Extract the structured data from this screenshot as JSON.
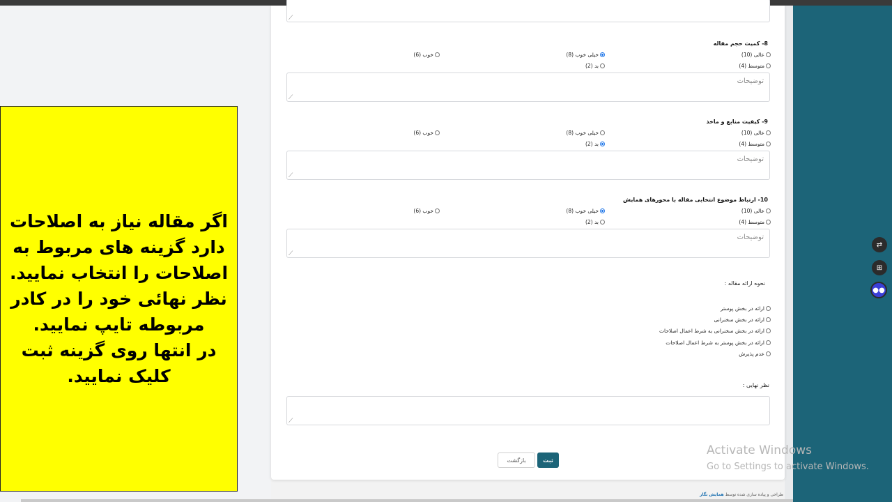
{
  "form": {
    "comments_placeholder": "توضیحات",
    "questions": [
      {
        "title": "8- کمیت حجم مقاله",
        "options": {
          "excellent": "عالی (10)",
          "very_good": "خیلی خوب (8)",
          "good": "خوب (6)",
          "average": "متوسط (4)",
          "bad": "بد (2)"
        },
        "selected": "very_good"
      },
      {
        "title": "9- کیفیت منابع و ماخذ",
        "options": {
          "excellent": "عالی (10)",
          "very_good": "خیلی خوب (8)",
          "good": "خوب (6)",
          "average": "متوسط (4)",
          "bad": "بد (2)"
        },
        "selected": "bad"
      },
      {
        "title": "10- ارتباط موضوع انتخابی مقاله با محورهای همایش",
        "options": {
          "excellent": "عالی (10)",
          "very_good": "خیلی خوب (8)",
          "good": "خوب (6)",
          "average": "متوسط (4)",
          "bad": "بد (2)"
        },
        "selected": "very_good"
      }
    ],
    "presentation": {
      "label": "نحوه ارائه مقاله :",
      "options": [
        "ارائه در بخش پوستر",
        "ارائه در بخش سخنرانی",
        "ارائه در بخش سخنرانی به شرط اعمال اصلاحات",
        "ارائه در بخش پوستر به شرط اعمال اصلاحات",
        "عدم پذیرش"
      ]
    },
    "final_opinion_label": "نظر نهایی :",
    "submit_label": "ثبت",
    "back_label": "بازگشت"
  },
  "footer": {
    "text": "طراحی و پیاده سازی شده توسط",
    "brand": "همایش نگار"
  },
  "instruction_note": {
    "text": "اگر  مقاله نیاز به اصلاحات دارد گزینه های مربوط به اصلاحات را انتخاب نمایید.\nنظر نهائی خود را در کادر مربوطه  تایپ نمایید.\n در انتها روی گزینه ثبت کلیک نمایید.",
    "background": "#ffff00"
  },
  "watermark": {
    "line1": "Activate Windows",
    "line2": "Go to Settings to activate Windows."
  },
  "side_buttons": [
    "translate-icon",
    "grid-icon",
    "assistant-icon"
  ],
  "colors": {
    "accent": "#1c6478",
    "radio_selected": "#1a73e8"
  }
}
